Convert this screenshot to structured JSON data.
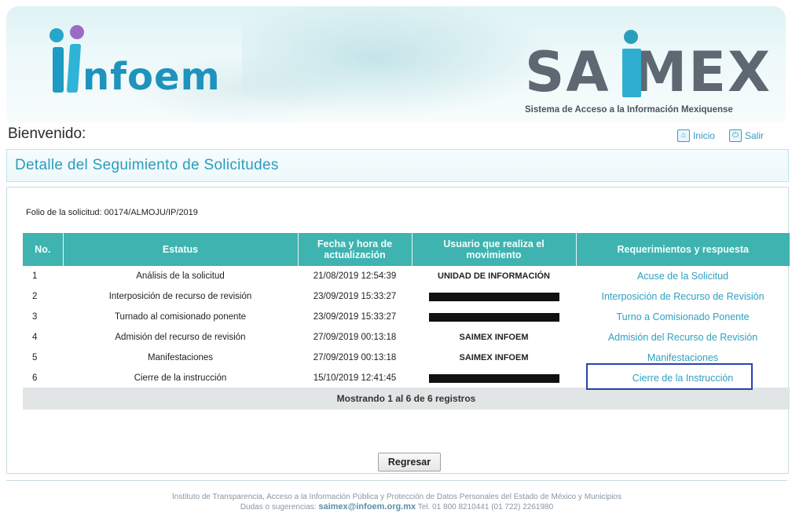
{
  "brand": {
    "infoem_name": "nfoem",
    "saimex_name": "SAMEX",
    "saimex_tagline": "Sistema de Acceso a la Información Mexiquense"
  },
  "header": {
    "welcome": "Bienvenido:",
    "nav": {
      "home": "Inicio",
      "logout": "Salir"
    }
  },
  "page": {
    "title": "Detalle del Seguimiento de Solicitudes",
    "folio_label": "Folio de la solicitud:",
    "folio_value": "00174/ALMOJU/IP/2019"
  },
  "table": {
    "headers": {
      "no": "No.",
      "status": "Estatus",
      "datetime": "Fecha y hora de actualización",
      "user": "Usuario que realiza el movimiento",
      "response": "Requerimientos y respuesta"
    },
    "rows": [
      {
        "no": "1",
        "status": "Análisis de la solicitud",
        "datetime": "21/08/2019 12:54:39",
        "user": "UNIDAD DE INFORMACIÓN",
        "response": "Acuse de la Solicitud"
      },
      {
        "no": "2",
        "status": "Interposición de recurso de revisión",
        "datetime": "23/09/2019 15:33:27",
        "user": "",
        "response": "Interposición de Recurso de Revisión"
      },
      {
        "no": "3",
        "status": "Turnado al comisionado ponente",
        "datetime": "23/09/2019 15:33:27",
        "user": "",
        "response": "Turno a Comisionado Ponente"
      },
      {
        "no": "4",
        "status": "Admisión del recurso de revisión",
        "datetime": "27/09/2019 00:13:18",
        "user": "SAIMEX INFOEM",
        "response": "Admisión del Recurso de Revisión"
      },
      {
        "no": "5",
        "status": "Manifestaciones",
        "datetime": "27/09/2019 00:13:18",
        "user": "SAIMEX INFOEM",
        "response": "Manifestaciones"
      },
      {
        "no": "6",
        "status": "Cierre de la instrucción",
        "datetime": "15/10/2019 12:41:45",
        "user": "",
        "response": "Cierre de la Instrucción"
      }
    ],
    "summary": "Mostrando 1 al 6 de 6 registros"
  },
  "actions": {
    "back": "Regresar"
  },
  "footer": {
    "line1": "Instituto de Transparencia, Acceso a la Información Pública y Protección de Datos Personales del Estado de México y Municipios",
    "line2_prefix": "Dudas o sugerencias:",
    "email": "saimex@infoem.org.mx",
    "phone": "Tel. 01 800 8210441 (01 722) 2261980"
  }
}
